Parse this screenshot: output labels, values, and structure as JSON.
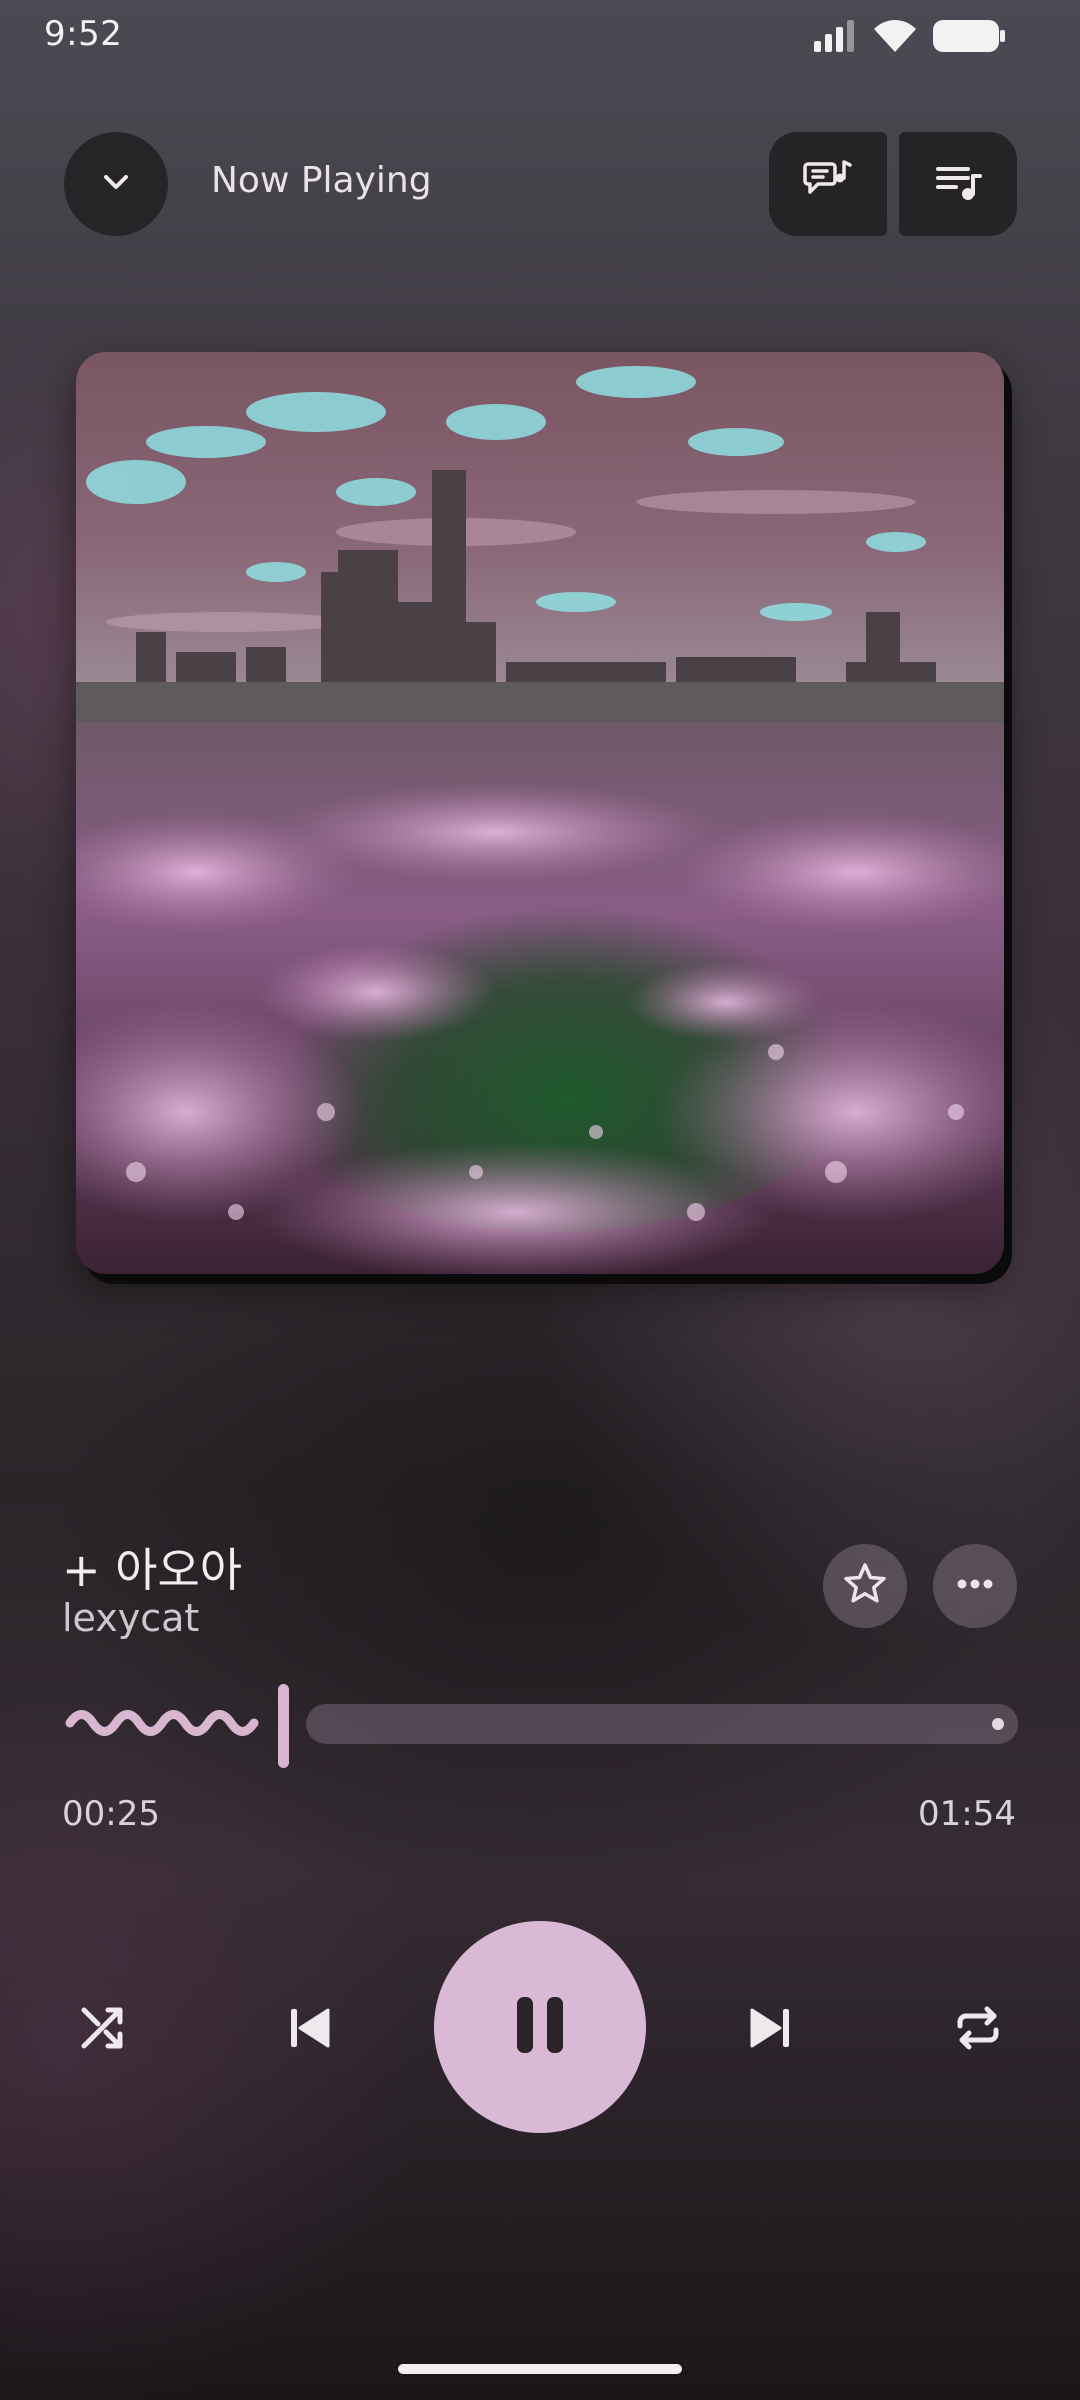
{
  "status_bar": {
    "time": "9:52",
    "icons": [
      "signal-icon",
      "wifi-icon",
      "battery-icon"
    ]
  },
  "header": {
    "title": "Now Playing",
    "collapse_icon": "chevron-down-icon",
    "lyrics_icon": "lyrics-icon",
    "queue_icon": "queue-music-icon"
  },
  "album_art": {
    "description_icon": "album-art-image"
  },
  "track": {
    "title": "+ 아오아",
    "artist": "lexycat",
    "favorite_icon": "star-outline-icon",
    "more_icon": "more-horizontal-icon"
  },
  "progress": {
    "elapsed": "00:25",
    "total": "01:54",
    "fraction": 0.22
  },
  "controls": {
    "shuffle_icon": "shuffle-icon",
    "previous_icon": "skip-previous-icon",
    "play_state_icon": "pause-icon",
    "next_icon": "skip-next-icon",
    "repeat_icon": "repeat-icon"
  },
  "colors": {
    "accent": "#d9b9d6",
    "button_bg": "#252326",
    "text_primary": "#f1edf0"
  }
}
